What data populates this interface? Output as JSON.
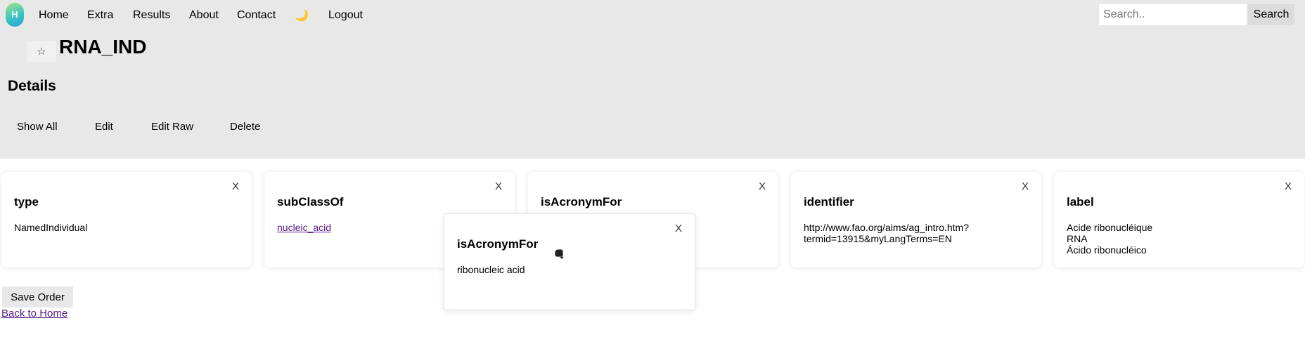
{
  "nav": {
    "logo_glyph": "H",
    "items": [
      "Home",
      "Extra",
      "Results",
      "About",
      "Contact",
      "🌙",
      "Logout"
    ],
    "search_placeholder": "Search..",
    "search_button": "Search"
  },
  "header": {
    "star_glyph": "☆",
    "title": "RNA_IND",
    "section": "Details"
  },
  "actions": [
    "Show All",
    "Edit",
    "Edit Raw",
    "Delete"
  ],
  "cards": [
    {
      "title": "type",
      "close": "X",
      "lines": [
        "NamedIndividual"
      ]
    },
    {
      "title": "subClassOf",
      "close": "X",
      "link": "nucleic_acid"
    },
    {
      "title": "isAcronymFor",
      "close": "X",
      "lines": []
    },
    {
      "title": "identifier",
      "close": "X",
      "lines": [
        "http://www.fao.org/aims/ag_intro.htm?",
        "termid=13915&myLangTerms=EN"
      ]
    },
    {
      "title": "label",
      "close": "X",
      "lines": [
        "Acide ribonucléique",
        "RNA",
        "Ácido ribonucléico"
      ]
    }
  ],
  "dragging_card": {
    "title": "isAcronymFor",
    "close": "X",
    "lines": [
      "ribonucleic acid"
    ]
  },
  "footer": {
    "save_order": "Save Order",
    "back_link": "Back to Home"
  },
  "colors": {
    "header_bg": "#e8e8e8",
    "visited_link": "#551a8b"
  }
}
